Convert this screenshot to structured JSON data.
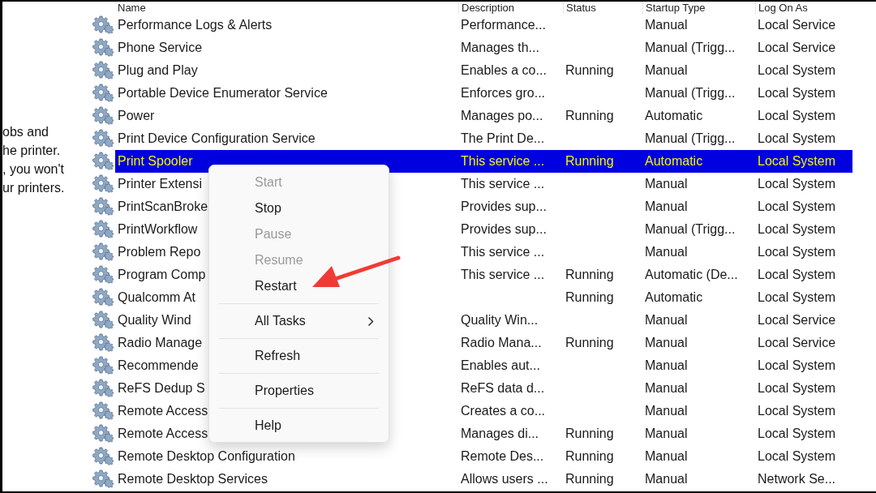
{
  "description_pane": {
    "lines": [
      "obs and",
      "he printer.",
      ", you won't",
      "ur printers."
    ]
  },
  "table": {
    "columns": [
      "Name",
      "Description",
      "Status",
      "Startup Type",
      "Log On As"
    ],
    "rows": [
      {
        "name": "Performance Logs & Alerts",
        "description": "Performance...",
        "status": "",
        "startup_type": "Manual",
        "log_on_as": "Local Service",
        "selected": false
      },
      {
        "name": "Phone Service",
        "description": "Manages th...",
        "status": "",
        "startup_type": "Manual (Trigg...",
        "log_on_as": "Local Service",
        "selected": false
      },
      {
        "name": "Plug and Play",
        "description": "Enables a co...",
        "status": "Running",
        "startup_type": "Manual",
        "log_on_as": "Local System",
        "selected": false
      },
      {
        "name": "Portable Device Enumerator Service",
        "description": "Enforces gro...",
        "status": "",
        "startup_type": "Manual (Trigg...",
        "log_on_as": "Local System",
        "selected": false
      },
      {
        "name": "Power",
        "description": "Manages po...",
        "status": "Running",
        "startup_type": "Automatic",
        "log_on_as": "Local System",
        "selected": false
      },
      {
        "name": "Print Device Configuration Service",
        "description": "The Print De...",
        "status": "",
        "startup_type": "Manual (Trigg...",
        "log_on_as": "Local System",
        "selected": false
      },
      {
        "name": "Print Spooler",
        "description": "This service ...",
        "status": "Running",
        "startup_type": "Automatic",
        "log_on_as": "Local System",
        "selected": true
      },
      {
        "name": "Printer Extensi",
        "description": "This service ...",
        "status": "",
        "startup_type": "Manual",
        "log_on_as": "Local System",
        "selected": false
      },
      {
        "name": "PrintScanBroke",
        "description": "Provides sup...",
        "status": "",
        "startup_type": "Manual",
        "log_on_as": "Local System",
        "selected": false
      },
      {
        "name": "PrintWorkflow",
        "description": "Provides sup...",
        "status": "",
        "startup_type": "Manual (Trigg...",
        "log_on_as": "Local System",
        "selected": false
      },
      {
        "name": "Problem Repo",
        "description": "This service ...",
        "status": "",
        "startup_type": "Manual",
        "log_on_as": "Local System",
        "selected": false
      },
      {
        "name": "Program Comp",
        "description": "This service ...",
        "status": "Running",
        "startup_type": "Automatic (De...",
        "log_on_as": "Local System",
        "selected": false
      },
      {
        "name": "Qualcomm At",
        "description": "",
        "status": "Running",
        "startup_type": "Automatic",
        "log_on_as": "Local System",
        "selected": false
      },
      {
        "name": "Quality Wind",
        "description": "Quality Win...",
        "status": "",
        "startup_type": "Manual",
        "log_on_as": "Local Service",
        "selected": false
      },
      {
        "name": "Radio Manage",
        "description": "Radio Mana...",
        "status": "Running",
        "startup_type": "Manual",
        "log_on_as": "Local Service",
        "selected": false
      },
      {
        "name": "Recommende",
        "description": "Enables aut...",
        "status": "",
        "startup_type": "Manual",
        "log_on_as": "Local System",
        "selected": false
      },
      {
        "name": "ReFS Dedup S",
        "description": "ReFS data d...",
        "status": "",
        "startup_type": "Manual",
        "log_on_as": "Local System",
        "selected": false
      },
      {
        "name": "Remote Access",
        "description": "Creates a co...",
        "status": "",
        "startup_type": "Manual",
        "log_on_as": "Local System",
        "selected": false
      },
      {
        "name": "Remote Access",
        "description": "Manages di...",
        "status": "Running",
        "startup_type": "Manual",
        "log_on_as": "Local System",
        "selected": false
      },
      {
        "name": "Remote Desktop Configuration",
        "description": "Remote Des...",
        "status": "Running",
        "startup_type": "Manual",
        "log_on_as": "Local System",
        "selected": false
      },
      {
        "name": "Remote Desktop Services",
        "description": "Allows users ...",
        "status": "Running",
        "startup_type": "Manual",
        "log_on_as": "Network Se...",
        "selected": false
      }
    ]
  },
  "context_menu": {
    "items": [
      {
        "kind": "item",
        "label": "Start",
        "disabled": true
      },
      {
        "kind": "item",
        "label": "Stop",
        "disabled": false
      },
      {
        "kind": "item",
        "label": "Pause",
        "disabled": true
      },
      {
        "kind": "item",
        "label": "Resume",
        "disabled": true
      },
      {
        "kind": "item",
        "label": "Restart",
        "disabled": false
      },
      {
        "kind": "separator"
      },
      {
        "kind": "submenu",
        "label": "All Tasks",
        "disabled": false
      },
      {
        "kind": "separator"
      },
      {
        "kind": "item",
        "label": "Refresh",
        "disabled": false
      },
      {
        "kind": "separator"
      },
      {
        "kind": "item",
        "label": "Properties",
        "disabled": false
      },
      {
        "kind": "separator"
      },
      {
        "kind": "item",
        "label": "Help",
        "disabled": false
      }
    ]
  }
}
